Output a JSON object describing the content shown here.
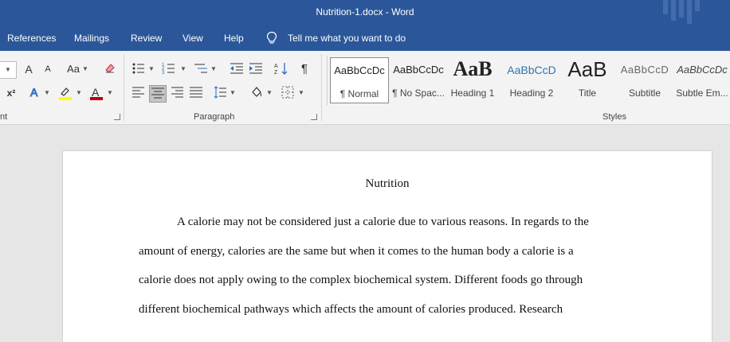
{
  "window": {
    "title": "Nutrition-1.docx  -  Word"
  },
  "menu": {
    "tabs": [
      "References",
      "Mailings",
      "Review",
      "View",
      "Help"
    ],
    "tell_me": "Tell me what you want to do"
  },
  "ribbon": {
    "groups": {
      "font_partial": "nt",
      "paragraph": "Paragraph",
      "styles": "Styles"
    },
    "font_buttons": {
      "grow": "A",
      "shrink": "A",
      "case": "Aa",
      "superscript": "x²"
    },
    "styles": [
      {
        "preview": "AaBbCcDc",
        "name": "¶ Normal",
        "selected": true
      },
      {
        "preview": "AaBbCcDc",
        "name": "¶ No Spac...",
        "selected": false
      },
      {
        "preview": "AaB",
        "name": "Heading 1",
        "selected": false
      },
      {
        "preview": "AaBbCcD",
        "name": "Heading 2",
        "selected": false
      },
      {
        "preview": "AaB",
        "name": "Title",
        "selected": false
      },
      {
        "preview": "AaBbCcD",
        "name": "Subtitle",
        "selected": false
      },
      {
        "preview": "AaBbCcDc",
        "name": "Subtle Em...",
        "selected": false
      }
    ]
  },
  "colors": {
    "highlight": "#ffff00",
    "font_color": "#c00000",
    "accent": "#2b579a"
  },
  "document": {
    "title": "Nutrition",
    "lines": [
      "A calorie may not be considered just a calorie due to various reasons. In regards to the",
      "amount of energy, calories are the same but when it comes to the human body a calorie is a",
      "calorie does not apply owing to the complex biochemical system. Different foods go through",
      "different biochemical pathways which affects the amount of calories produced. Research"
    ]
  }
}
